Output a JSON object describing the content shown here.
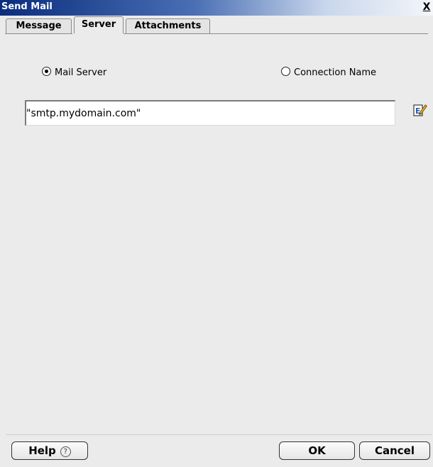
{
  "window": {
    "title": "Send Mail",
    "close_label": "X"
  },
  "tabs": [
    {
      "label": "Message",
      "active": false
    },
    {
      "label": "Server",
      "active": true
    },
    {
      "label": "Attachments",
      "active": false
    }
  ],
  "server": {
    "mail_server_label": "Mail Server",
    "mail_server_checked": true,
    "connection_name_label": "Connection Name",
    "connection_name_checked": false,
    "host_value": "\"smtp.mydomain.com\""
  },
  "buttons": {
    "help_label": "Help",
    "help_icon_glyph": "?",
    "ok_label": "OK",
    "cancel_label": "Cancel"
  },
  "icons": {
    "edit": "edit-expression-icon",
    "help": "help-circle-icon"
  },
  "colors": {
    "titlebar_start": "#0b2d7e",
    "dialog_bg": "#ebebeb"
  }
}
